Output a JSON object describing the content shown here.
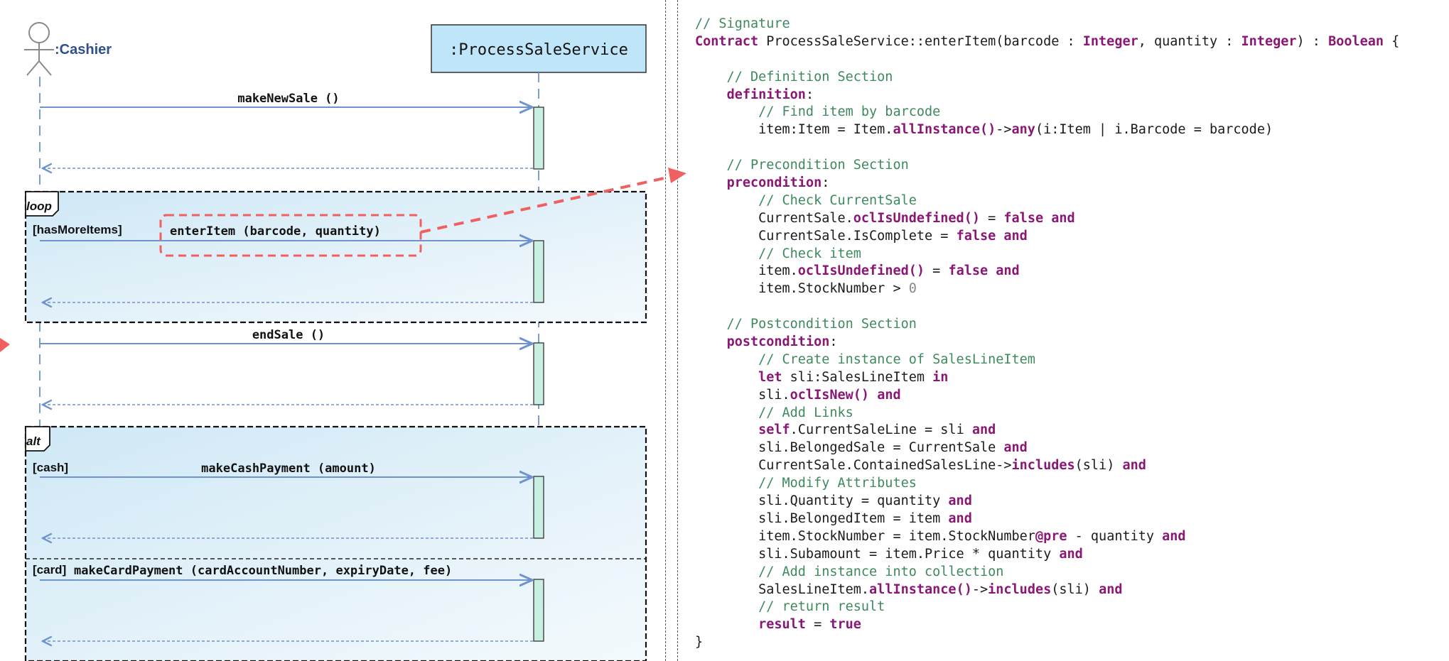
{
  "diagram": {
    "actor": {
      "label": ":Cashier"
    },
    "service": {
      "label": ":ProcessSaleService"
    },
    "messages": [
      {
        "label": "makeNewSale ()"
      },
      {
        "label": "enterItem (barcode, quantity)"
      },
      {
        "label": "endSale ()"
      },
      {
        "label": "makeCashPayment (amount)"
      },
      {
        "label": "makeCardPayment (cardAccountNumber, expiryDate, fee)"
      }
    ],
    "fragments": {
      "loop": {
        "keyword": "loop",
        "guard": "[hasMoreItems]"
      },
      "alt": {
        "keyword": "alt",
        "guard_1": "[cash]",
        "guard_2": "[card]"
      }
    },
    "colors": {
      "frame_fill": "#dceef8",
      "service_fill": "#bfe6f8",
      "activation_fill": "#c9efe3",
      "message_line": "#6f93cf",
      "highlight": "#f06060"
    }
  },
  "code": {
    "lines": [
      [
        {
          "t": "// Signature",
          "c": "comment"
        }
      ],
      [
        {
          "t": "Contract",
          "c": "kw"
        },
        {
          "t": " ProcessSaleService::enterItem(barcode : ",
          "c": "plain"
        },
        {
          "t": "Integer",
          "c": "type"
        },
        {
          "t": ", quantity : ",
          "c": "plain"
        },
        {
          "t": "Integer",
          "c": "type"
        },
        {
          "t": ") : ",
          "c": "plain"
        },
        {
          "t": "Boolean",
          "c": "type"
        },
        {
          "t": " {",
          "c": "plain"
        }
      ],
      [
        {
          "t": "",
          "c": "plain"
        }
      ],
      [
        {
          "t": "    // Definition Section",
          "c": "comment"
        }
      ],
      [
        {
          "t": "    ",
          "c": "plain"
        },
        {
          "t": "definition",
          "c": "kw"
        },
        {
          "t": ":",
          "c": "plain"
        }
      ],
      [
        {
          "t": "        // Find item by barcode",
          "c": "comment"
        }
      ],
      [
        {
          "t": "        item:Item = Item.",
          "c": "plain"
        },
        {
          "t": "allInstance()",
          "c": "method"
        },
        {
          "t": "->",
          "c": "plain"
        },
        {
          "t": "any",
          "c": "method"
        },
        {
          "t": "(i:Item | i.Barcode = barcode)",
          "c": "plain"
        }
      ],
      [
        {
          "t": "",
          "c": "plain"
        }
      ],
      [
        {
          "t": "    // Precondition Section",
          "c": "comment"
        }
      ],
      [
        {
          "t": "    ",
          "c": "plain"
        },
        {
          "t": "precondition",
          "c": "kw"
        },
        {
          "t": ":",
          "c": "plain"
        }
      ],
      [
        {
          "t": "        // Check CurrentSale",
          "c": "comment"
        }
      ],
      [
        {
          "t": "        CurrentSale.",
          "c": "plain"
        },
        {
          "t": "oclIsUndefined()",
          "c": "method"
        },
        {
          "t": " = ",
          "c": "plain"
        },
        {
          "t": "false",
          "c": "kw"
        },
        {
          "t": " ",
          "c": "plain"
        },
        {
          "t": "and",
          "c": "kw"
        }
      ],
      [
        {
          "t": "        CurrentSale.IsComplete = ",
          "c": "plain"
        },
        {
          "t": "false",
          "c": "kw"
        },
        {
          "t": " ",
          "c": "plain"
        },
        {
          "t": "and",
          "c": "kw"
        }
      ],
      [
        {
          "t": "        // Check item",
          "c": "comment"
        }
      ],
      [
        {
          "t": "        item.",
          "c": "plain"
        },
        {
          "t": "oclIsUndefined()",
          "c": "method"
        },
        {
          "t": " = ",
          "c": "plain"
        },
        {
          "t": "false",
          "c": "kw"
        },
        {
          "t": " ",
          "c": "plain"
        },
        {
          "t": "and",
          "c": "kw"
        }
      ],
      [
        {
          "t": "        item.StockNumber > ",
          "c": "plain"
        },
        {
          "t": "0",
          "c": "num"
        }
      ],
      [
        {
          "t": "",
          "c": "plain"
        }
      ],
      [
        {
          "t": "    // Postcondition Section",
          "c": "comment"
        }
      ],
      [
        {
          "t": "    ",
          "c": "plain"
        },
        {
          "t": "postcondition",
          "c": "kw"
        },
        {
          "t": ":",
          "c": "plain"
        }
      ],
      [
        {
          "t": "        // Create instance of SalesLineItem",
          "c": "comment"
        }
      ],
      [
        {
          "t": "        ",
          "c": "plain"
        },
        {
          "t": "let",
          "c": "kw"
        },
        {
          "t": " sli:SalesLineItem ",
          "c": "plain"
        },
        {
          "t": "in",
          "c": "kw"
        }
      ],
      [
        {
          "t": "        sli.",
          "c": "plain"
        },
        {
          "t": "oclIsNew()",
          "c": "method"
        },
        {
          "t": " ",
          "c": "plain"
        },
        {
          "t": "and",
          "c": "kw"
        }
      ],
      [
        {
          "t": "        // Add Links",
          "c": "comment"
        }
      ],
      [
        {
          "t": "        ",
          "c": "plain"
        },
        {
          "t": "self",
          "c": "kw"
        },
        {
          "t": ".CurrentSaleLine = sli ",
          "c": "plain"
        },
        {
          "t": "and",
          "c": "kw"
        }
      ],
      [
        {
          "t": "        sli.BelongedSale = CurrentSale ",
          "c": "plain"
        },
        {
          "t": "and",
          "c": "kw"
        }
      ],
      [
        {
          "t": "        CurrentSale.ContainedSalesLine->",
          "c": "plain"
        },
        {
          "t": "includes",
          "c": "method"
        },
        {
          "t": "(sli) ",
          "c": "plain"
        },
        {
          "t": "and",
          "c": "kw"
        }
      ],
      [
        {
          "t": "        // Modify Attributes",
          "c": "comment"
        }
      ],
      [
        {
          "t": "        sli.Quantity = quantity ",
          "c": "plain"
        },
        {
          "t": "and",
          "c": "kw"
        }
      ],
      [
        {
          "t": "        sli.BelongedItem = item ",
          "c": "plain"
        },
        {
          "t": "and",
          "c": "kw"
        }
      ],
      [
        {
          "t": "        item.StockNumber = item.StockNumber",
          "c": "plain"
        },
        {
          "t": "@pre",
          "c": "kw"
        },
        {
          "t": " - quantity ",
          "c": "plain"
        },
        {
          "t": "and",
          "c": "kw"
        }
      ],
      [
        {
          "t": "        sli.Subamount = item.Price * quantity ",
          "c": "plain"
        },
        {
          "t": "and",
          "c": "kw"
        }
      ],
      [
        {
          "t": "        // Add instance into collection",
          "c": "comment"
        }
      ],
      [
        {
          "t": "        SalesLineItem.",
          "c": "plain"
        },
        {
          "t": "allInstance()",
          "c": "method"
        },
        {
          "t": "->",
          "c": "plain"
        },
        {
          "t": "includes",
          "c": "method"
        },
        {
          "t": "(sli) ",
          "c": "plain"
        },
        {
          "t": "and",
          "c": "kw"
        }
      ],
      [
        {
          "t": "        // return result",
          "c": "comment"
        }
      ],
      [
        {
          "t": "        ",
          "c": "plain"
        },
        {
          "t": "result",
          "c": "kw"
        },
        {
          "t": " = ",
          "c": "plain"
        },
        {
          "t": "true",
          "c": "kw"
        }
      ],
      [
        {
          "t": "}",
          "c": "plain"
        }
      ]
    ]
  }
}
